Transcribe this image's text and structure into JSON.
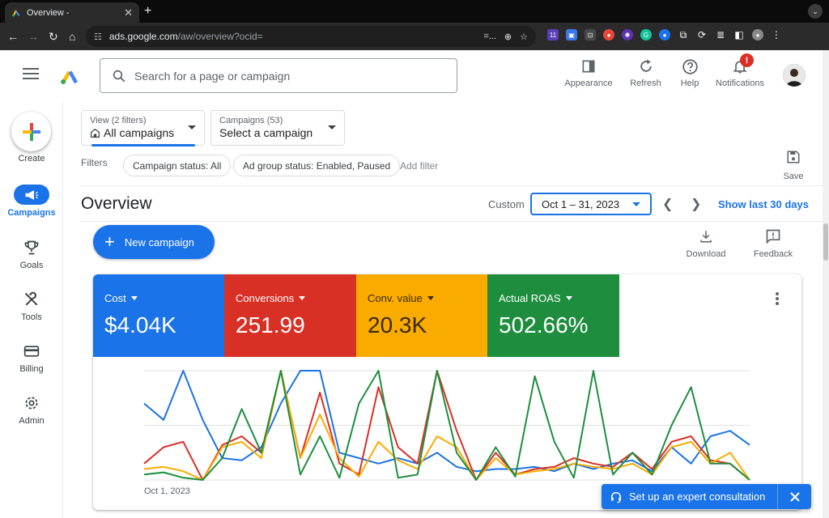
{
  "browser": {
    "tab_title": "Overview -",
    "url_host": "ads.google.com",
    "url_path": "/aw/overview?ocid=",
    "url_suffix": "=..."
  },
  "header": {
    "search_placeholder": "Search for a page or campaign",
    "buttons": {
      "appearance": "Appearance",
      "refresh": "Refresh",
      "help": "Help",
      "notifications": "Notifications"
    },
    "notification_badge": "!"
  },
  "sidenav": {
    "create": "Create",
    "items": [
      {
        "label": "Campaigns",
        "icon": "megaphone-icon",
        "active": true
      },
      {
        "label": "Goals",
        "icon": "trophy-icon"
      },
      {
        "label": "Tools",
        "icon": "tools-icon"
      },
      {
        "label": "Billing",
        "icon": "credit-card-icon"
      },
      {
        "label": "Admin",
        "icon": "gear-icon"
      }
    ]
  },
  "view_selector": {
    "label": "View (2 filters)",
    "value": "All campaigns"
  },
  "campaign_selector": {
    "label": "Campaigns (53)",
    "value": "Select a campaign"
  },
  "filters": {
    "label": "Filters",
    "chips": [
      "Campaign status: All",
      "Ad group status: Enabled, Paused"
    ],
    "add": "Add filter",
    "save": "Save"
  },
  "overview": {
    "title": "Overview",
    "date_mode": "Custom",
    "date_range": "Oct 1 – 31, 2023",
    "show_last": "Show last 30 days",
    "new_campaign": "New campaign",
    "download": "Download",
    "feedback": "Feedback"
  },
  "metrics": [
    {
      "label": "Cost",
      "value": "$4.04K",
      "color": "#1a73e8"
    },
    {
      "label": "Conversions",
      "value": "251.99",
      "color": "#d93025"
    },
    {
      "label": "Conv. value",
      "value": "20.3K",
      "color": "#f9ab00"
    },
    {
      "label": "Actual ROAS",
      "value": "502.66%",
      "color": "#1e8e3e"
    }
  ],
  "chart_data": {
    "type": "line",
    "x_start_label": "Oct 1, 2023",
    "ylim": [
      0,
      100
    ],
    "series": [
      {
        "name": "Cost",
        "color": "#1a73e8",
        "values": [
          70,
          55,
          100,
          55,
          20,
          18,
          30,
          70,
          100,
          100,
          25,
          20,
          15,
          20,
          15,
          25,
          12,
          8,
          10,
          10,
          12,
          8,
          15,
          10,
          15,
          18,
          8,
          30,
          15,
          40,
          45,
          32
        ]
      },
      {
        "name": "Conversions",
        "color": "#d93025",
        "values": [
          15,
          30,
          35,
          0,
          32,
          40,
          25,
          100,
          20,
          80,
          15,
          5,
          85,
          30,
          15,
          100,
          45,
          0,
          25,
          5,
          10,
          12,
          20,
          15,
          12,
          25,
          10,
          35,
          40,
          18,
          15,
          0
        ]
      },
      {
        "name": "Conv. value",
        "color": "#f9ab00",
        "values": [
          10,
          12,
          8,
          0,
          30,
          35,
          20,
          100,
          20,
          60,
          20,
          3,
          35,
          18,
          10,
          40,
          30,
          0,
          20,
          5,
          8,
          10,
          15,
          12,
          10,
          15,
          5,
          30,
          35,
          15,
          25,
          0
        ]
      },
      {
        "name": "Actual ROAS",
        "color": "#1e8e3e",
        "values": [
          5,
          7,
          2,
          0,
          20,
          65,
          25,
          100,
          5,
          40,
          2,
          70,
          100,
          2,
          5,
          100,
          25,
          0,
          30,
          3,
          95,
          35,
          2,
          100,
          5,
          25,
          5,
          50,
          85,
          15,
          15,
          0
        ]
      }
    ]
  },
  "toast": {
    "message": "Set up an expert consultation"
  }
}
